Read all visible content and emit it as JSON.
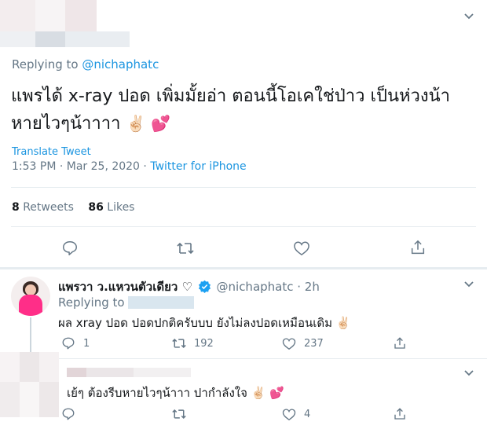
{
  "main_tweet": {
    "replying_to_prefix": "Replying to ",
    "replying_to_handle": "@nichaphatc",
    "text_line1": "แพรได้ x-ray ปอด เพิ่มมั้ยอ่า ตอนนี้โอเคใช่ป่าว เป็นห่วงน้า",
    "text_line2": "หายไวๆน้าาาา",
    "emoji_peace": "✌🏻",
    "emoji_hearts": "💕",
    "translate_label": "Translate Tweet",
    "timestamp": "1:53 PM · Mar 25, 2020 · ",
    "source": "Twitter for iPhone",
    "retweets_count": "8",
    "retweets_label": "Retweets",
    "likes_count": "86",
    "likes_label": "Likes"
  },
  "reply1": {
    "display_name": "แพรวา ว.แหวนตัวเดียว ♡",
    "handle_time": "@nichaphatc · 2h",
    "replying_to_prefix": "Replying to ",
    "text": "ผล xray ปอด ปอดปกติครับบบ ยังไม่ลงปอดเหมือนเดิม",
    "emoji": "✌🏻",
    "reply_count": "1",
    "retweet_count": "192",
    "like_count": "237"
  },
  "reply2": {
    "text": "เย้ๆ ต้องรีบหายไวๆน้าาา ปากำลังใจ",
    "emoji_peace": "✌🏻",
    "emoji_hearts": "💕",
    "like_count": "4"
  },
  "colors": {
    "accent": "#1b95e0",
    "muted": "#657786",
    "verified": "#1da1f2",
    "avatar_pink": "#ff2e88",
    "blur_block": "#d9e6ef"
  }
}
